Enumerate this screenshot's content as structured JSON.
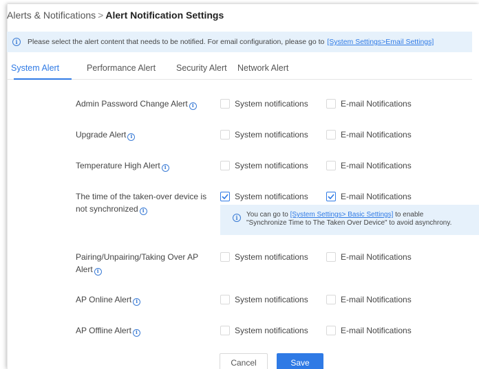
{
  "breadcrumb": {
    "parent": "Alerts & Notifications",
    "separator": ">",
    "current": "Alert Notification Settings"
  },
  "info_bar": {
    "text": "Please select the alert content that needs to be notified. For email configuration, please go to",
    "link": "[System Settings>Email Settings]"
  },
  "tabs": [
    {
      "label": "System Alert",
      "active": true
    },
    {
      "label": "Performance Alert",
      "active": false
    },
    {
      "label": "Security Alert",
      "active": false
    },
    {
      "label": "Network Alert",
      "active": false
    }
  ],
  "option_labels": {
    "system": "System notifications",
    "email": "E-mail Notifications"
  },
  "alerts": [
    {
      "label": "Admin Password Change Alert",
      "system": false,
      "email": false
    },
    {
      "label": "Upgrade Alert",
      "system": false,
      "email": false
    },
    {
      "label": "Temperature High Alert",
      "system": false,
      "email": false
    },
    {
      "label": "The time of the taken-over device is not synchronized",
      "system": true,
      "email": true
    },
    {
      "label": "Pairing/Unpairing/Taking Over AP Alert",
      "system": false,
      "email": false
    },
    {
      "label": "AP Online Alert",
      "system": false,
      "email": false
    },
    {
      "label": "AP Offline Alert",
      "system": false,
      "email": false
    }
  ],
  "sync_tip": {
    "prefix": "You can go to",
    "link": "[System Settings> Basic Settings]",
    "suffix": "to enable",
    "line2": "\"Synchronize Time to The Taken Over Device\" to avoid asynchrony."
  },
  "buttons": {
    "cancel": "Cancel",
    "save": "Save"
  },
  "colors": {
    "accent": "#2f7ae5",
    "info_background": "#e6f1fb"
  }
}
